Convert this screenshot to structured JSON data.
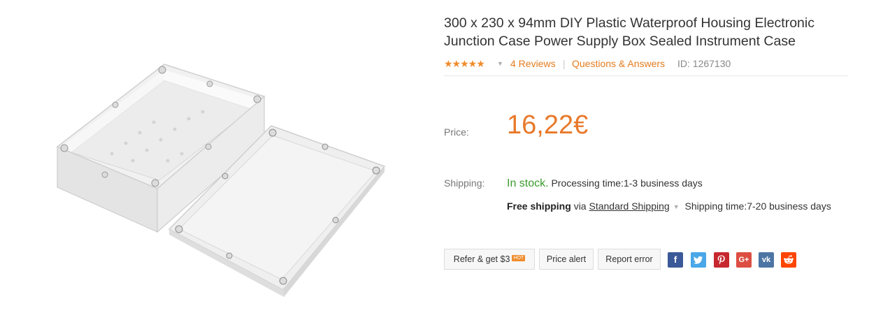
{
  "product": {
    "title": "300 x 230 x 94mm DIY Plastic Waterproof Housing Electronic Junction Case Power Supply Box Sealed Instrument Case",
    "image_icon": "plastic-enclosure-box-image"
  },
  "rating": {
    "stars": "★★★★★",
    "value": 5,
    "reviews_link": "4 Reviews",
    "qa_link": "Questions & Answers",
    "id_text": "ID: 1267130"
  },
  "price": {
    "label": "Price:",
    "value": "16,22€"
  },
  "shipping": {
    "label": "Shipping:",
    "in_stock": "In stock.",
    "processing": "Processing time:1-3 business days",
    "free": "Free shipping",
    "via": "via",
    "method": "Standard Shipping",
    "shipping_time": "Shipping time:7-20 business days"
  },
  "actions": {
    "refer": "Refer & get $3",
    "hot_badge": "HOT",
    "price_alert": "Price alert",
    "report_error": "Report error"
  },
  "social": {
    "facebook": "f",
    "googleplus": "G+",
    "vk": "vk"
  },
  "colors": {
    "accent": "#e8792a",
    "link": "#e57c1f",
    "stock": "#3a9b2c"
  }
}
